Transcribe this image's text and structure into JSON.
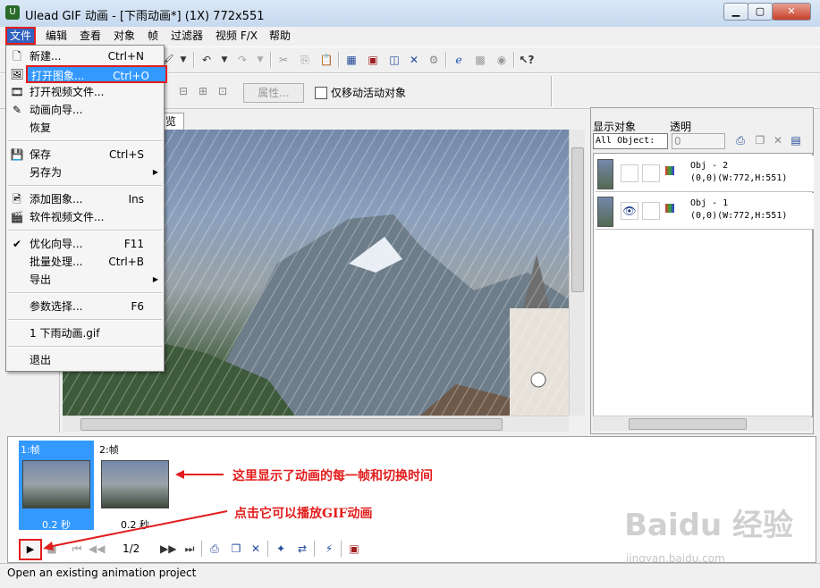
{
  "window": {
    "title": "Ulead GIF 动画 - [下雨动画*] (1X) 772x551",
    "icon": "ulead-app-icon",
    "controls": [
      "minimize",
      "maximize",
      "close"
    ]
  },
  "menubar": [
    "文件",
    "编辑",
    "查看",
    "对象",
    "帧",
    "过滤器",
    "视频 F/X",
    "帮助"
  ],
  "file_menu": {
    "items": [
      {
        "label": "新建...",
        "shortcut": "Ctrl+N",
        "icon": "new-doc-icon"
      },
      {
        "label": "打开图象...",
        "shortcut": "Ctrl+O",
        "icon": "open-image-icon",
        "highlighted": true
      },
      {
        "label": "打开视频文件...",
        "shortcut": "",
        "icon": "open-video-icon"
      },
      {
        "label": "动画向导...",
        "shortcut": "",
        "icon": "wizard-icon"
      },
      {
        "label": "恢复",
        "shortcut": "",
        "icon": ""
      },
      {
        "label": "保存",
        "shortcut": "Ctrl+S",
        "icon": "save-icon"
      },
      {
        "label": "另存为",
        "shortcut": "",
        "icon": "",
        "submenu": true
      },
      {
        "label": "添加图象...",
        "shortcut": "Ins",
        "icon": "add-image-icon"
      },
      {
        "label": "软件视频文件...",
        "shortcut": "",
        "icon": "add-video-icon"
      },
      {
        "label": "优化向导...",
        "shortcut": "F11",
        "icon": "optimize-icon"
      },
      {
        "label": "批量处理...",
        "shortcut": "Ctrl+B",
        "icon": ""
      },
      {
        "label": "导出",
        "shortcut": "",
        "icon": "",
        "submenu": true
      },
      {
        "label": "参数选择...",
        "shortcut": "F6",
        "icon": ""
      },
      {
        "label": "1 下雨动画.gif",
        "shortcut": "",
        "icon": ""
      },
      {
        "label": "退出",
        "shortcut": "",
        "icon": ""
      }
    ]
  },
  "toolbar2": {
    "properties_button": "属性...",
    "move_active_only_checkbox": "仅移动活动对象",
    "move_active_only_checked": false
  },
  "canvas_tab": {
    "label": "览"
  },
  "object_panel": {
    "show_objects_label": "显示对象",
    "transparency_label": "透明",
    "show_objects_value": "All Object:",
    "transparency_value": "0",
    "objects": [
      {
        "name": "Obj - 2",
        "info": "(0,0)(W:772,H:551)",
        "visible": false
      },
      {
        "name": "Obj - 1",
        "info": "(0,0)(W:772,H:551)",
        "visible": true
      }
    ]
  },
  "frame_panel": {
    "frames": [
      {
        "label": "1:帧",
        "time": "0.2 秒",
        "selected": true
      },
      {
        "label": "2:帧",
        "time": "0.2 秒",
        "selected": false
      }
    ],
    "frame_counter": "1/2"
  },
  "annotations": {
    "frames_note": "这里显示了动画的每一帧和切换时间",
    "play_note": "点击它可以播放GIF动画"
  },
  "status_bar": {
    "text": "Open an existing animation project"
  },
  "watermark": {
    "brand": "Baidu 经验",
    "url": "jingyan.baidu.com"
  },
  "colors": {
    "highlight": "#3399ff",
    "annotation_red": "#e31d1d"
  }
}
